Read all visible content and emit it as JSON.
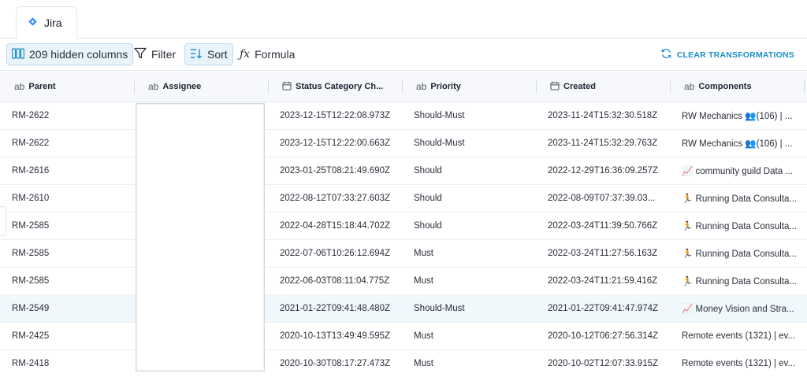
{
  "tab": {
    "label": "Jira",
    "icon": "jira-diamond-icon"
  },
  "toolbar": {
    "hidden_columns_label": "209 hidden columns",
    "filter_label": "Filter",
    "sort_label": "Sort",
    "formula_label": "Formula",
    "formula_symbol": "ƒx",
    "clear_label": "CLEAR TRANSFORMATIONS"
  },
  "colors": {
    "accent": "#1d8fc9",
    "jira": "#2684ff",
    "active_bg": "#e8f3fa",
    "highlight_row": "#f0f8fc"
  },
  "columns": [
    {
      "type": "ab",
      "label": "Parent"
    },
    {
      "type": "ab",
      "label": "Assignee"
    },
    {
      "type": "calendar-icon",
      "label": "Status Category Ch..."
    },
    {
      "type": "ab",
      "label": "Priority"
    },
    {
      "type": "calendar-icon",
      "label": "Created"
    },
    {
      "type": "ab",
      "label": "Components"
    }
  ],
  "rows": [
    {
      "parent": "RM-2622",
      "status_changed": "2023-12-15T12:22:08.973Z",
      "priority": "Should-Must",
      "created": "2023-11-24T15:32:30.518Z",
      "components": "RW Mechanics 👥(106) | ..."
    },
    {
      "parent": "RM-2622",
      "status_changed": "2023-12-15T12:22:00.663Z",
      "priority": "Should-Must",
      "created": "2023-11-24T15:32:29.763Z",
      "components": "RW Mechanics 👥(106) | ..."
    },
    {
      "parent": "RM-2616",
      "status_changed": "2023-01-25T08:21:49.690Z",
      "priority": "Should",
      "created": "2022-12-29T16:36:09.257Z",
      "components": "📈 community guild Data ..."
    },
    {
      "parent": "RM-2610",
      "status_changed": "2022-08-12T07:33:27.603Z",
      "priority": "Should",
      "created": "2022-08-09T07:37:39.03...",
      "components": "🏃 Running Data Consulta..."
    },
    {
      "parent": "RM-2585",
      "status_changed": "2022-04-28T15:18:44.702Z",
      "priority": "Should",
      "created": "2022-03-24T11:39:50.766Z",
      "components": "🏃 Running Data Consulta..."
    },
    {
      "parent": "RM-2585",
      "status_changed": "2022-07-06T10:26:12.694Z",
      "priority": "Must",
      "created": "2022-03-24T11:27:56.163Z",
      "components": "🏃 Running Data Consulta..."
    },
    {
      "parent": "RM-2585",
      "status_changed": "2022-06-03T08:11:04.775Z",
      "priority": "Must",
      "created": "2022-03-24T11:21:59.416Z",
      "components": "🏃 Running Data Consulta..."
    },
    {
      "parent": "RM-2549",
      "status_changed": "2021-01-22T09:41:48.480Z",
      "priority": "Should-Must",
      "created": "2021-01-22T09:41:47.974Z",
      "components": "📈 Money Vision and Stra..."
    },
    {
      "parent": "RM-2425",
      "status_changed": "2020-10-13T13:49:49.595Z",
      "priority": "Must",
      "created": "2020-10-12T06:27:56.314Z",
      "components": "Remote events (1321) | ev..."
    },
    {
      "parent": "RM-2418",
      "status_changed": "2020-10-30T08:17:27.473Z",
      "priority": "Must",
      "created": "2020-10-02T12:07:33.915Z",
      "components": "Remote events (1321) | ev..."
    }
  ]
}
